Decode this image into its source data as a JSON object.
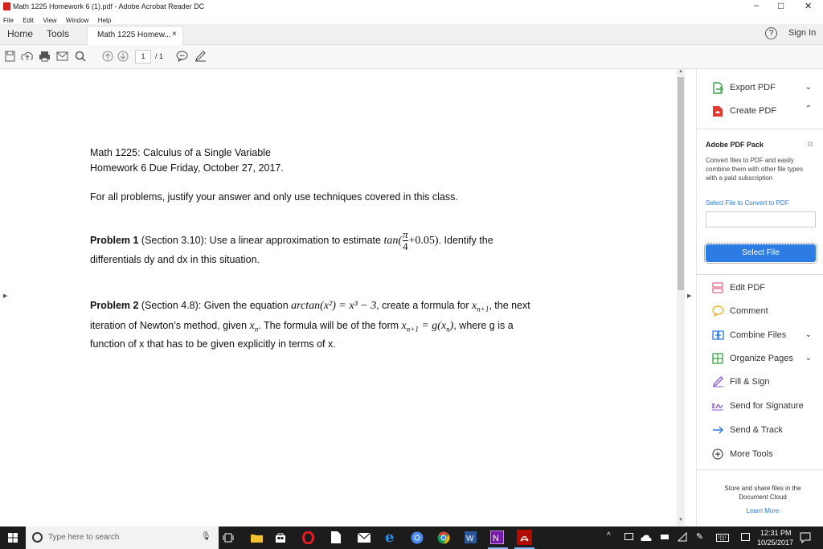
{
  "window": {
    "title": "Math 1225 Homework 6 (1).pdf - Adobe Acrobat Reader DC",
    "controls": {
      "minimize": "–",
      "maximize": "□",
      "close": "✕"
    }
  },
  "menu": [
    "File",
    "Edit",
    "View",
    "Window",
    "Help"
  ],
  "tabs": {
    "home": "Home",
    "tools": "Tools",
    "doc_tab": "Math 1225 Homew...",
    "doc_tab_close": "×"
  },
  "header_right": {
    "help": "?",
    "sign_in": "Sign In"
  },
  "toolbar": {
    "page_current": "1",
    "page_total": "/ 1"
  },
  "document": {
    "title_line1": "Math 1225: Calculus of a Single Variable",
    "title_line2": "Homework 6 Due Friday, October 27, 2017.",
    "instructions": "For all problems, justify your answer and only use techniques covered in this class.",
    "p1_label": "Problem 1",
    "p1_text_a": " (Section 3.10): Use a linear approximation to estimate ",
    "p1_math_fn": "tan(",
    "p1_math_num": "π",
    "p1_math_den": "4",
    "p1_math_rest": "+0.05)",
    "p1_text_b": ". Identify the",
    "p1_text_c": "differentials dy and dx in this situation.",
    "p2_label": "Problem 2",
    "p2_text_a": " (Section 4.8): Given the equation ",
    "p2_math_eq": "arctan(x²) = x³ − 3",
    "p2_text_b": ", create a formula for ",
    "p2_math_x": "x",
    "p2_math_sub": "n+1",
    "p2_text_c": ", the next",
    "p2_line2_a": "iteration of Newton’s method, given ",
    "p2_line2_x": "x",
    "p2_line2_xsub": "n",
    "p2_line2_b": ". The formula will be of the form ",
    "p2_line2_form": "x",
    "p2_line2_formsub": "n+1",
    "p2_line2_form2": " = g(x",
    "p2_line2_form2sub": "n",
    "p2_line2_form3": ")",
    "p2_line2_c": ", where g is a",
    "p2_line3": "function of x that has to be given explicitly in terms of x."
  },
  "right_panel": {
    "export_pdf": "Export PDF",
    "create_pdf": "Create PDF",
    "pack_title": "Adobe PDF Pack",
    "pack_desc": "Convert files to PDF and easily combine them with other file types with a paid subscription",
    "select_file_link": "Select File to Convert to PDF",
    "select_file_button": "Select File",
    "tools": [
      "Edit PDF",
      "Comment",
      "Combine Files",
      "Organize Pages",
      "Fill & Sign",
      "Send for Signature",
      "Send & Track",
      "More Tools"
    ],
    "cloud_text": "Store and share files in the Document Cloud",
    "learn_more": "Learn More"
  },
  "taskbar": {
    "search_placeholder": "Type here to search",
    "time": "12:31 PM",
    "date": "10/25/2017"
  },
  "colors": {
    "accent_blue": "#2d7be4",
    "acrobat_red": "#d4221f",
    "taskbar": "#1c1c1c"
  }
}
